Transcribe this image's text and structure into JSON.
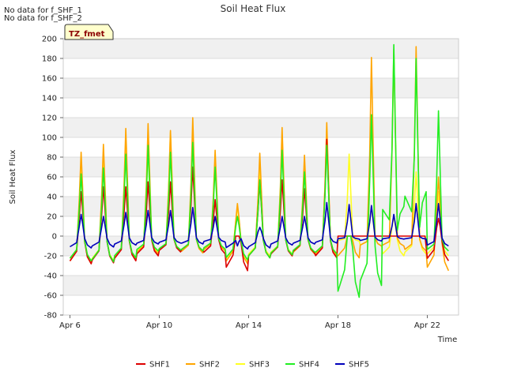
{
  "notes": {
    "line1": "No data for f_SHF_1",
    "line2": "No data for f_SHF_2"
  },
  "site_tag": "TZ_fmet",
  "colors": {
    "SHF1": "#dd0000",
    "SHF2": "#ffa500",
    "SHF3": "#ffff22",
    "SHF4": "#22ee22",
    "SHF5": "#0000bb",
    "band": "#f0f0f0",
    "grid": "#dddddd",
    "axis": "#cccccc",
    "tag_fill": "#ffffcc",
    "tag_border": "#333333"
  },
  "chart_data": {
    "type": "line",
    "title": "Soil Heat Flux",
    "xlabel": "Time",
    "ylabel": "Soil Heat Flux",
    "xlim": [
      -0.3,
      17.4
    ],
    "ylim": [
      -80,
      200
    ],
    "yticks": [
      -80,
      -60,
      -40,
      -20,
      0,
      20,
      40,
      60,
      80,
      100,
      120,
      140,
      160,
      180,
      200
    ],
    "xticks": [
      {
        "day": 0,
        "label": "Apr 6"
      },
      {
        "day": 4,
        "label": "Apr 10"
      },
      {
        "day": 8,
        "label": "Apr 14"
      },
      {
        "day": 12,
        "label": "Apr 18"
      },
      {
        "day": 16,
        "label": "Apr 22"
      }
    ],
    "legend_position": "bottom",
    "series": [
      {
        "name": "SHF1",
        "peaks": [
          45,
          50,
          50,
          55,
          55,
          70,
          37,
          0,
          55,
          57,
          48,
          98,
          0,
          0,
          0,
          0,
          18
        ],
        "troughs": [
          -28,
          -27,
          -25,
          -20,
          -16,
          -15,
          -18,
          -35,
          -22,
          -20,
          -17,
          -22,
          0,
          0,
          0,
          0,
          -25
        ],
        "flat_from_day": 13.6,
        "flat_to_day": 16.6
      },
      {
        "name": "SHF2",
        "peaks": [
          85,
          93,
          109,
          114,
          107,
          120,
          87,
          33,
          84,
          110,
          82,
          115,
          0,
          181,
          189,
          192,
          60
        ],
        "troughs": [
          -28,
          -26,
          -24,
          -18,
          -15,
          -17,
          -15,
          -28,
          -22,
          -20,
          -18,
          -20,
          -22,
          -10,
          -10,
          -15,
          -35
        ],
        "flat_from_day": 14.5,
        "flat_to_day": 15.5
      },
      {
        "name": "SHF3",
        "peaks": [
          72,
          83,
          87,
          90,
          105,
          100,
          80,
          30,
          67,
          100,
          70,
          110,
          83,
          30,
          20,
          65,
          45
        ],
        "troughs": [
          -25,
          -25,
          -22,
          -16,
          -14,
          -15,
          -14,
          -25,
          -20,
          -18,
          -16,
          -18,
          -5,
          -10,
          -20,
          -18,
          -20
        ]
      },
      {
        "name": "SHF4",
        "peaks": [
          63,
          69,
          83,
          92,
          85,
          95,
          70,
          20,
          57,
          87,
          65,
          92,
          0,
          123,
          194,
          180,
          127
        ],
        "troughs": [
          -25,
          -26,
          -22,
          -15,
          -14,
          -15,
          -13,
          -24,
          -22,
          -19,
          -16,
          -18,
          -62,
          -50,
          30,
          45,
          -15
        ]
      },
      {
        "name": "SHF5",
        "peaks": [
          22,
          20,
          24,
          26,
          26,
          29,
          20,
          -10,
          9,
          20,
          20,
          34,
          32,
          31,
          22,
          33,
          33
        ],
        "troughs": [
          -12,
          -11,
          -9,
          -8,
          -7,
          -8,
          -6,
          -13,
          -12,
          -9,
          -8,
          -7,
          -3,
          -5,
          -3,
          -3,
          -10
        ]
      }
    ]
  }
}
